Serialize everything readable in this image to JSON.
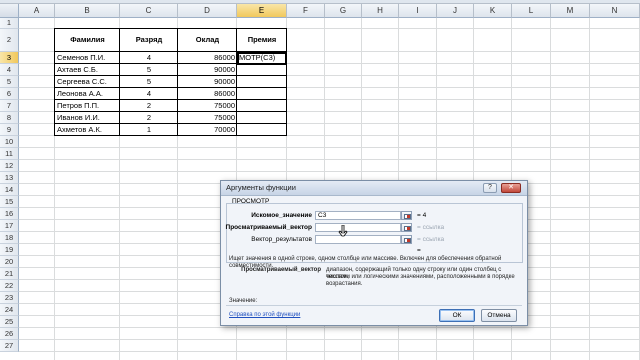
{
  "sheet": {
    "columns": [
      "A",
      "B",
      "C",
      "D",
      "E",
      "F",
      "G",
      "H",
      "I",
      "J",
      "K",
      "L",
      "M",
      "N"
    ],
    "rows": [
      "1",
      "2",
      "3",
      "4",
      "5",
      "6",
      "7",
      "8",
      "9",
      "10",
      "11",
      "12",
      "13",
      "14",
      "15",
      "16",
      "17",
      "18",
      "19",
      "20",
      "21",
      "22",
      "23",
      "24",
      "25",
      "26",
      "27"
    ],
    "active_column": "E",
    "active_row": "3",
    "table": {
      "headers": [
        "Фамилия",
        "Разряд",
        "Оклад",
        "Премия"
      ],
      "rows": [
        [
          "Семенов П.И.",
          "4",
          "86000",
          "МОТР(С3)"
        ],
        [
          "Ахтаев С.Б.",
          "5",
          "90000",
          ""
        ],
        [
          "Сергеева С.С.",
          "5",
          "90000",
          ""
        ],
        [
          "Леонова А.А.",
          "4",
          "86000",
          ""
        ],
        [
          "Петров П.П.",
          "2",
          "75000",
          ""
        ],
        [
          "Иванов И.И.",
          "2",
          "75000",
          ""
        ],
        [
          "Ахметов А.К.",
          "1",
          "70000",
          ""
        ]
      ]
    }
  },
  "dialog": {
    "title": "Аргументы функции",
    "help_button": "?",
    "close_button": "✕",
    "function_name": "ПРОСМОТР",
    "args": [
      {
        "label": "Искомое_значение",
        "bold": true,
        "value": "C3",
        "result": "= 4",
        "result_gray": false
      },
      {
        "label": "Просматриваемый_вектор",
        "bold": true,
        "value": "",
        "result": "= ссылка",
        "result_gray": true
      },
      {
        "label": "Вектор_результатов",
        "bold": false,
        "value": "",
        "result": "= ссылка",
        "result_gray": true
      }
    ],
    "formula_result_eq": "=",
    "description": "Ищет значения в одной строке, одном столбце или массиве. Включен для обеспечения обратной совместимости.",
    "arg_help_label": "Просматриваемый_вектор",
    "arg_help_text_1": "диапазон, содержащий только одну строку или один столбец с текстом,",
    "arg_help_text_2": "числами или логическими значениями, расположенными в порядке",
    "arg_help_text_3": "возрастания.",
    "value_label": "Значение:",
    "help_link": "Справка по этой функции",
    "ok_label": "ОК",
    "cancel_label": "Отмена"
  }
}
